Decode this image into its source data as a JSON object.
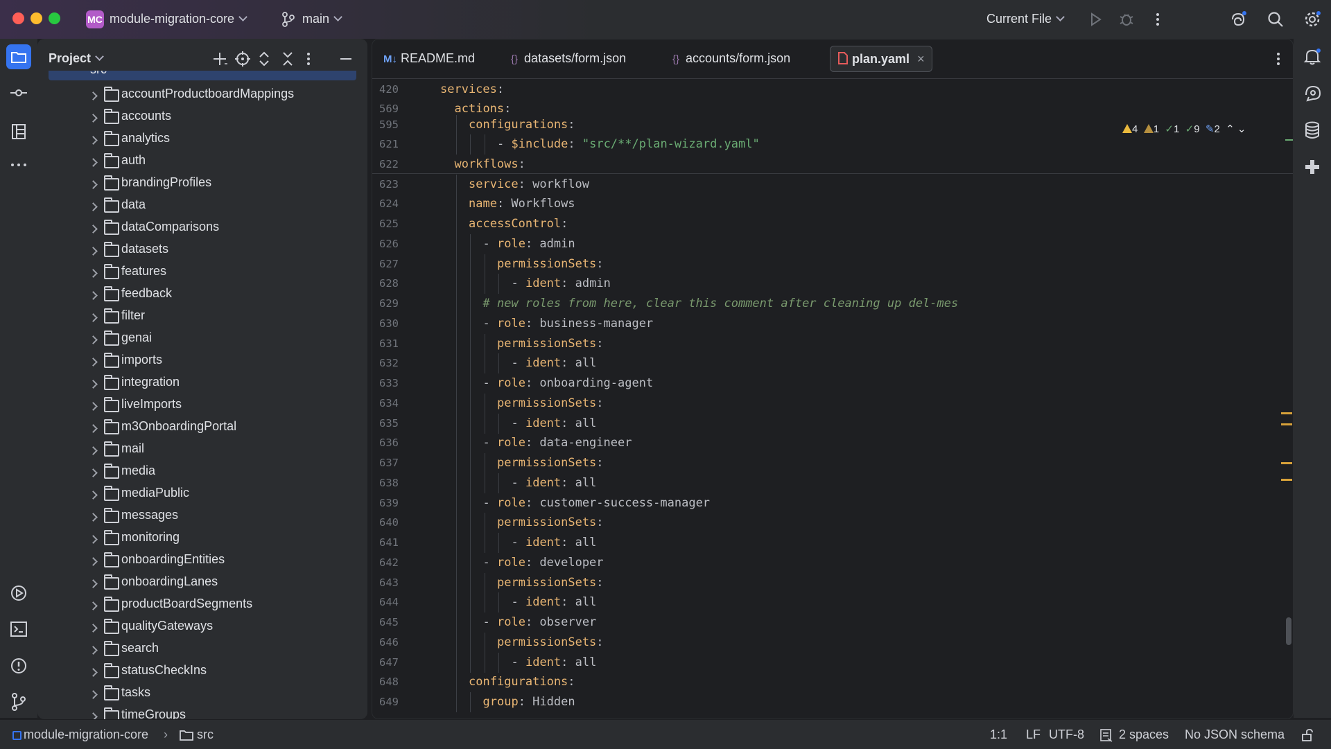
{
  "window": {
    "project_initials": "MC",
    "project_name": "module-migration-core",
    "branch": "main",
    "run_config": "Current File"
  },
  "project_panel": {
    "title": "Project",
    "partial_top_folder": "src",
    "folders": [
      "accountProductboardMappings",
      "accounts",
      "analytics",
      "auth",
      "brandingProfiles",
      "data",
      "dataComparisons",
      "datasets",
      "features",
      "feedback",
      "filter",
      "genai",
      "imports",
      "integration",
      "liveImports",
      "m3OnboardingPortal",
      "mail",
      "media",
      "mediaPublic",
      "messages",
      "monitoring",
      "onboardingEntities",
      "onboardingLanes",
      "productBoardSegments",
      "qualityGateways",
      "search",
      "statusCheckIns",
      "tasks",
      "timeGroups"
    ]
  },
  "tabs": [
    {
      "icon": "M↓",
      "label": "README.md"
    },
    {
      "icon": "{}",
      "label": "datasets/form.json"
    },
    {
      "icon": "{}",
      "label": "accounts/form.json"
    },
    {
      "icon": "yaml",
      "label": "plan.yaml"
    }
  ],
  "inspections": {
    "warnings": "4",
    "weak_warnings": "1",
    "typos": "1",
    "ok": "9",
    "edits": "2"
  },
  "sticky_lines": [
    {
      "num": "420",
      "indent": 0,
      "parts": [
        [
          "k",
          "services"
        ],
        [
          "p",
          ":"
        ]
      ]
    },
    {
      "num": "569",
      "indent": 1,
      "parts": [
        [
          "k",
          "actions"
        ],
        [
          "p",
          ":"
        ]
      ]
    },
    {
      "num": "595",
      "indent": 2,
      "parts": [
        [
          "k",
          "configurations"
        ],
        [
          "p",
          ":"
        ]
      ]
    }
  ],
  "code_lines": [
    {
      "num": "621",
      "indent": 4,
      "parts": [
        [
          "p",
          "- "
        ],
        [
          "k",
          "$include"
        ],
        [
          "p",
          ": "
        ],
        [
          "s",
          "\"src/**/plan-wizard.yaml\""
        ]
      ]
    },
    {
      "num": "622",
      "indent": 1,
      "parts": [
        [
          "k",
          "workflows"
        ],
        [
          "p",
          ":"
        ]
      ]
    },
    {
      "num": "623",
      "indent": 2,
      "parts": [
        [
          "k",
          "service"
        ],
        [
          "p",
          ": workflow"
        ]
      ]
    },
    {
      "num": "624",
      "indent": 2,
      "parts": [
        [
          "k",
          "name"
        ],
        [
          "p",
          ": Workflows"
        ]
      ]
    },
    {
      "num": "625",
      "indent": 2,
      "parts": [
        [
          "k",
          "accessControl"
        ],
        [
          "p",
          ":"
        ]
      ]
    },
    {
      "num": "626",
      "indent": 3,
      "parts": [
        [
          "p",
          "- "
        ],
        [
          "k",
          "role"
        ],
        [
          "p",
          ": admin"
        ]
      ]
    },
    {
      "num": "627",
      "indent": 4,
      "parts": [
        [
          "k",
          "permissionSets"
        ],
        [
          "p",
          ":"
        ]
      ]
    },
    {
      "num": "628",
      "indent": 5,
      "parts": [
        [
          "p",
          "- "
        ],
        [
          "k",
          "ident"
        ],
        [
          "p",
          ": admin"
        ]
      ]
    },
    {
      "num": "629",
      "indent": 3,
      "parts": [
        [
          "c",
          "# new roles from here, clear this comment after cleaning up del-mes"
        ]
      ]
    },
    {
      "num": "630",
      "indent": 3,
      "parts": [
        [
          "p",
          "- "
        ],
        [
          "k",
          "role"
        ],
        [
          "p",
          ": business-manager"
        ]
      ]
    },
    {
      "num": "631",
      "indent": 4,
      "parts": [
        [
          "k",
          "permissionSets"
        ],
        [
          "p",
          ":"
        ]
      ]
    },
    {
      "num": "632",
      "indent": 5,
      "parts": [
        [
          "p",
          "- "
        ],
        [
          "k",
          "ident"
        ],
        [
          "p",
          ": all"
        ]
      ]
    },
    {
      "num": "633",
      "indent": 3,
      "parts": [
        [
          "p",
          "- "
        ],
        [
          "k",
          "role"
        ],
        [
          "p",
          ": onboarding-agent"
        ]
      ]
    },
    {
      "num": "634",
      "indent": 4,
      "parts": [
        [
          "k",
          "permissionSets"
        ],
        [
          "p",
          ":"
        ]
      ]
    },
    {
      "num": "635",
      "indent": 5,
      "parts": [
        [
          "p",
          "- "
        ],
        [
          "k",
          "ident"
        ],
        [
          "p",
          ": all"
        ]
      ]
    },
    {
      "num": "636",
      "indent": 3,
      "parts": [
        [
          "p",
          "- "
        ],
        [
          "k",
          "role"
        ],
        [
          "p",
          ": data-engineer"
        ]
      ]
    },
    {
      "num": "637",
      "indent": 4,
      "parts": [
        [
          "k",
          "permissionSets"
        ],
        [
          "p",
          ":"
        ]
      ]
    },
    {
      "num": "638",
      "indent": 5,
      "parts": [
        [
          "p",
          "- "
        ],
        [
          "k",
          "ident"
        ],
        [
          "p",
          ": all"
        ]
      ]
    },
    {
      "num": "639",
      "indent": 3,
      "parts": [
        [
          "p",
          "- "
        ],
        [
          "k",
          "role"
        ],
        [
          "p",
          ": customer-success-manager"
        ]
      ]
    },
    {
      "num": "640",
      "indent": 4,
      "parts": [
        [
          "k",
          "permissionSets"
        ],
        [
          "p",
          ":"
        ]
      ]
    },
    {
      "num": "641",
      "indent": 5,
      "parts": [
        [
          "p",
          "- "
        ],
        [
          "k",
          "ident"
        ],
        [
          "p",
          ": all"
        ]
      ]
    },
    {
      "num": "642",
      "indent": 3,
      "parts": [
        [
          "p",
          "- "
        ],
        [
          "k",
          "role"
        ],
        [
          "p",
          ": developer"
        ]
      ]
    },
    {
      "num": "643",
      "indent": 4,
      "parts": [
        [
          "k",
          "permissionSets"
        ],
        [
          "p",
          ":"
        ]
      ]
    },
    {
      "num": "644",
      "indent": 5,
      "parts": [
        [
          "p",
          "- "
        ],
        [
          "k",
          "ident"
        ],
        [
          "p",
          ": all"
        ]
      ]
    },
    {
      "num": "645",
      "indent": 3,
      "parts": [
        [
          "p",
          "- "
        ],
        [
          "k",
          "role"
        ],
        [
          "p",
          ": observer"
        ]
      ]
    },
    {
      "num": "646",
      "indent": 4,
      "parts": [
        [
          "k",
          "permissionSets"
        ],
        [
          "p",
          ":"
        ]
      ]
    },
    {
      "num": "647",
      "indent": 5,
      "parts": [
        [
          "p",
          "- "
        ],
        [
          "k",
          "ident"
        ],
        [
          "p",
          ": all"
        ]
      ]
    },
    {
      "num": "648",
      "indent": 2,
      "parts": [
        [
          "k",
          "configurations"
        ],
        [
          "p",
          ":"
        ]
      ]
    },
    {
      "num": "649",
      "indent": 3,
      "parts": [
        [
          "k",
          "group"
        ],
        [
          "p",
          ": Hidden"
        ]
      ]
    }
  ],
  "statusbar": {
    "breadcrumb_project": "module-migration-core",
    "breadcrumb_folder": "src",
    "position": "1:1",
    "line_separator": "LF",
    "encoding": "UTF-8",
    "indent": "2 spaces",
    "schema": "No JSON schema"
  },
  "colors": {
    "accent": "#3574f0",
    "key": "#e8b573",
    "string": "#6aab73",
    "comment": "#7a9a6e",
    "warning": "#e9b93d",
    "project_badge": "#b25bc8"
  }
}
